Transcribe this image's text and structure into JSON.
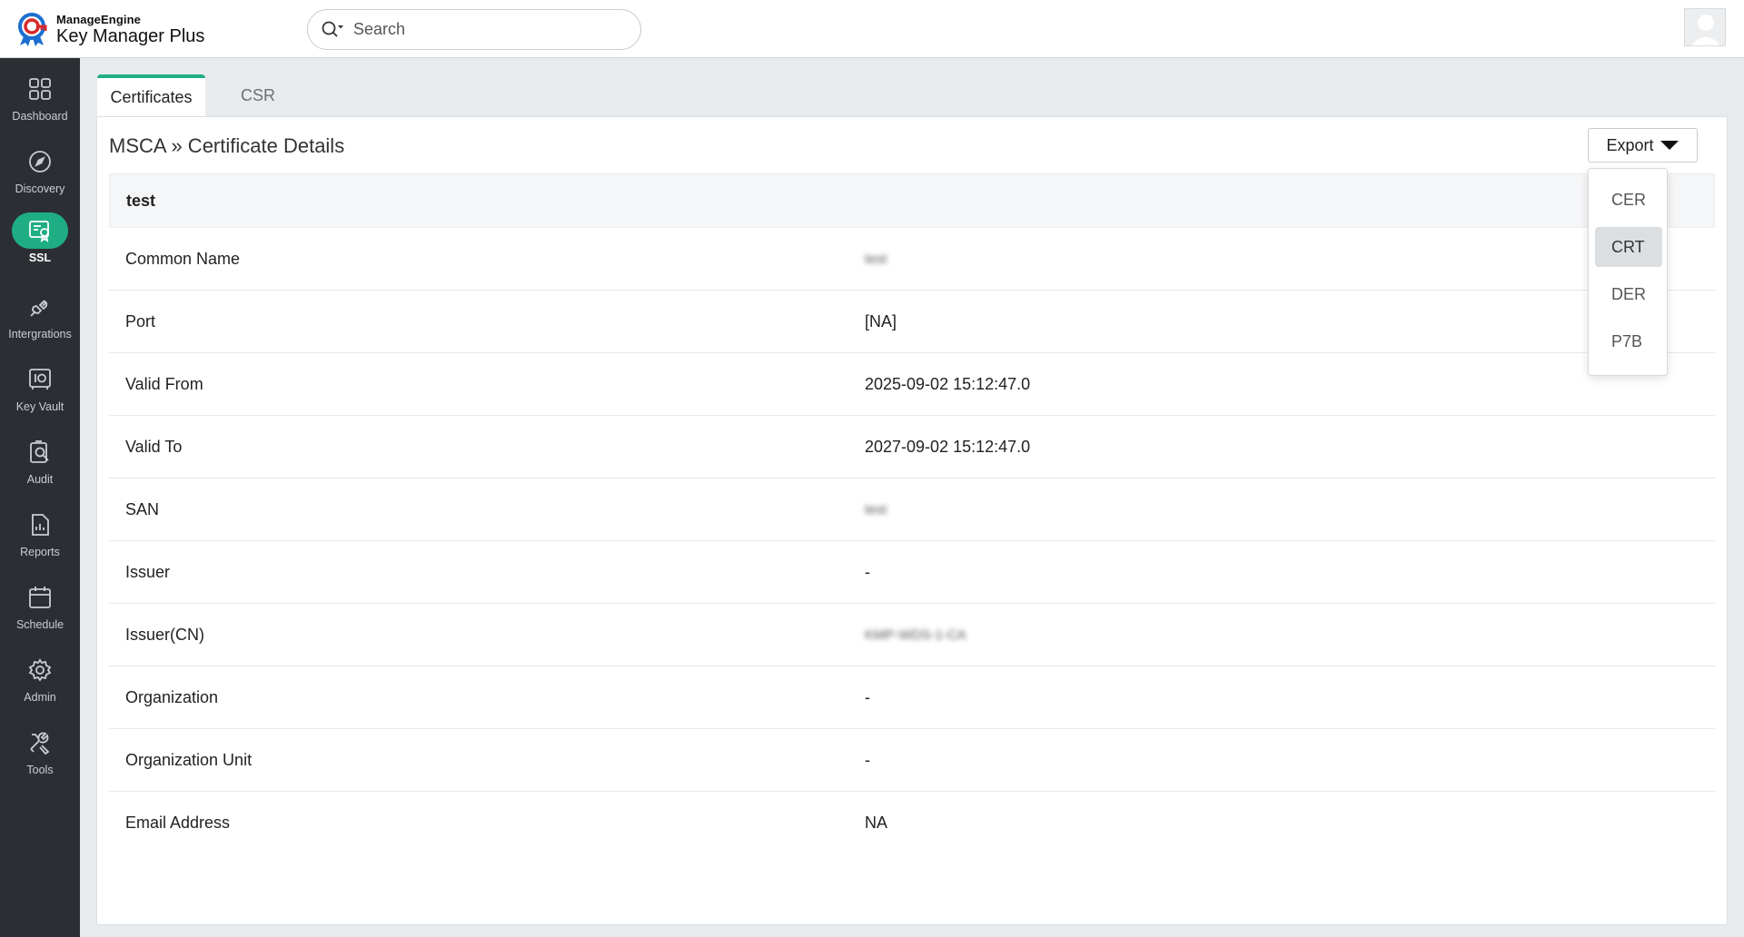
{
  "brand": {
    "company": "ManageEngine",
    "product_bold": "Key Manager",
    "product_rest": " Plus"
  },
  "search": {
    "placeholder": "Search"
  },
  "sidebar": {
    "items": [
      {
        "label": "Dashboard",
        "icon": "dashboard-icon"
      },
      {
        "label": "Discovery",
        "icon": "compass-icon"
      },
      {
        "label": "SSL",
        "icon": "certificate-icon",
        "active": true
      },
      {
        "label": "Intergrations",
        "icon": "plug-icon"
      },
      {
        "label": "Key Vault",
        "icon": "vault-icon"
      },
      {
        "label": "Audit",
        "icon": "audit-search-icon"
      },
      {
        "label": "Reports",
        "icon": "report-icon"
      },
      {
        "label": "Schedule",
        "icon": "calendar-icon"
      },
      {
        "label": "Admin",
        "icon": "gear-icon"
      },
      {
        "label": "Tools",
        "icon": "tools-icon"
      }
    ]
  },
  "tabs": [
    {
      "label": "Certificates",
      "active": true
    },
    {
      "label": "CSR",
      "active": false
    }
  ],
  "main": {
    "title": "MSCA » Certificate Details",
    "export_label": "Export",
    "table_header": "test",
    "rows": [
      {
        "label": "Common Name",
        "value": "test",
        "blurred": true
      },
      {
        "label": "Port",
        "value": "[NA]"
      },
      {
        "label": "Valid From",
        "value": "2025-09-02 15:12:47.0"
      },
      {
        "label": "Valid To",
        "value": "2027-09-02 15:12:47.0"
      },
      {
        "label": "SAN",
        "value": "test",
        "blurred": true
      },
      {
        "label": "Issuer",
        "value": "-"
      },
      {
        "label": "Issuer(CN)",
        "value": "KMP-WDS-1-CA",
        "blurred": true
      },
      {
        "label": "Organization",
        "value": "-"
      },
      {
        "label": "Organization Unit",
        "value": "-"
      },
      {
        "label": "Email Address",
        "value": "NA"
      }
    ]
  },
  "export_menu": {
    "options": [
      "CER",
      "CRT",
      "DER",
      "P7B"
    ],
    "highlighted": "CRT"
  },
  "colors": {
    "accent": "#1fae84",
    "sidebar": "#2b2f34"
  }
}
